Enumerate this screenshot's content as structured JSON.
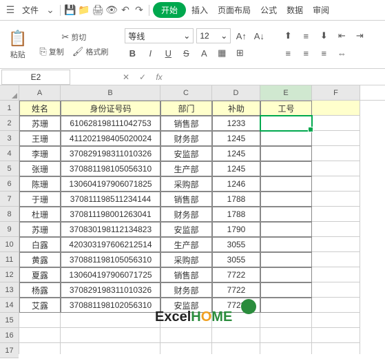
{
  "menu": {
    "file": "文件",
    "start": "开始",
    "insert": "插入",
    "layout": "页面布局",
    "formula": "公式",
    "data": "数据",
    "review": "审阅"
  },
  "tb": {
    "paste": "粘贴",
    "cut": "剪切",
    "copy": "复制",
    "format": "格式刷",
    "font": "等线",
    "size": "12"
  },
  "namebox": "E2",
  "headers": {
    "name": "姓名",
    "id": "身份证号码",
    "dept": "部门",
    "allow": "补助",
    "empid": "工号"
  },
  "cols": [
    "A",
    "B",
    "C",
    "D",
    "E",
    "F"
  ],
  "rows": [
    {
      "n": "苏珊",
      "i": "610628198111042753",
      "d": "销售部",
      "a": "1233"
    },
    {
      "n": "王珊",
      "i": "411202198405020024",
      "d": "财务部",
      "a": "1245"
    },
    {
      "n": "李珊",
      "i": "370829198311010326",
      "d": "安监部",
      "a": "1245"
    },
    {
      "n": "张珊",
      "i": "370881198105056310",
      "d": "生产部",
      "a": "1245"
    },
    {
      "n": "陈珊",
      "i": "130604197906071825",
      "d": "采购部",
      "a": "1246"
    },
    {
      "n": "于珊",
      "i": "370811198511234144",
      "d": "销售部",
      "a": "1788"
    },
    {
      "n": "杜珊",
      "i": "370811198001263041",
      "d": "财务部",
      "a": "1788"
    },
    {
      "n": "苏珊",
      "i": "370830198112134823",
      "d": "安监部",
      "a": "1790"
    },
    {
      "n": "白露",
      "i": "420303197606212514",
      "d": "生产部",
      "a": "3055"
    },
    {
      "n": "黄露",
      "i": "370881198105056310",
      "d": "采购部",
      "a": "3055"
    },
    {
      "n": "夏露",
      "i": "130604197906071725",
      "d": "销售部",
      "a": "7722"
    },
    {
      "n": "杨露",
      "i": "370829198311010326",
      "d": "财务部",
      "a": "7722"
    },
    {
      "n": "艾露",
      "i": "370881198102056310",
      "d": "安监部",
      "a": "7728"
    }
  ],
  "watermark": {
    "a": "Excel",
    "b": "H",
    "c": "O",
    "d": "ME"
  }
}
